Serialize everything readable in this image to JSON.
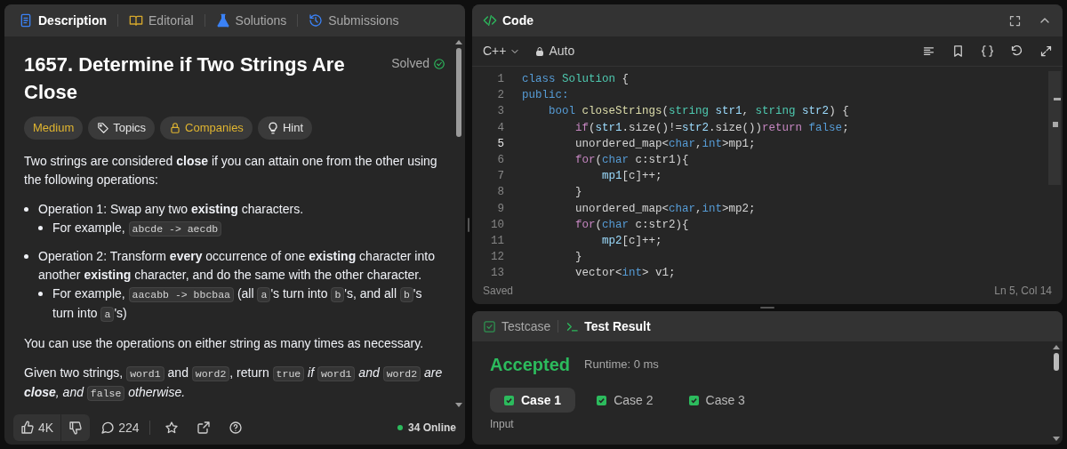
{
  "description_panel": {
    "tabs": [
      {
        "label": "Description",
        "selected": true
      },
      {
        "label": "Editorial",
        "selected": false
      },
      {
        "label": "Solutions",
        "selected": false
      },
      {
        "label": "Submissions",
        "selected": false
      }
    ],
    "title": "1657. Determine if Two Strings Are Close",
    "status": "Solved",
    "tags": [
      {
        "label": "Medium",
        "kind": "difficulty"
      },
      {
        "label": "Topics",
        "kind": "topics"
      },
      {
        "label": "Companies",
        "kind": "companies"
      },
      {
        "label": "Hint",
        "kind": "hint"
      }
    ],
    "content": [
      {
        "kind": "paragraph",
        "segments": [
          {
            "kind": "text",
            "text": "Two strings are considered **close** if you can attain one from the other using the following operations:"
          }
        ]
      },
      {
        "kind": "list",
        "items": [
          {
            "segments": [
              {
                "kind": "text",
                "text": "Operation 1: Swap any two **existing** characters."
              }
            ],
            "children": [
              {
                "segments": [
                  {
                    "kind": "text",
                    "text": "For example, "
                  },
                  {
                    "kind": "code",
                    "text": "abcde -> aecdb"
                  }
                ]
              }
            ]
          },
          {
            "segments": [
              {
                "kind": "text",
                "text": "Operation 2: Transform **every** occurrence of one **existing** character into another **existing** character, and do the same with the other character."
              }
            ],
            "children": [
              {
                "segments": [
                  {
                    "kind": "text",
                    "text": "For example, "
                  },
                  {
                    "kind": "code",
                    "text": "aacabb -> bbcbaa"
                  },
                  {
                    "kind": "text",
                    "text": " (all "
                  },
                  {
                    "kind": "code",
                    "text": "a"
                  },
                  {
                    "kind": "text",
                    "text": "'s turn into "
                  },
                  {
                    "kind": "code",
                    "text": "b"
                  },
                  {
                    "kind": "text",
                    "text": "'s, and all "
                  },
                  {
                    "kind": "code",
                    "text": "b"
                  },
                  {
                    "kind": "text",
                    "text": "'s turn into "
                  },
                  {
                    "kind": "code",
                    "text": "a"
                  },
                  {
                    "kind": "text",
                    "text": "'s)"
                  }
                ]
              }
            ]
          }
        ]
      },
      {
        "kind": "paragraph",
        "segments": [
          {
            "kind": "text",
            "text": "You can use the operations on either string as many times as necessary."
          }
        ]
      },
      {
        "kind": "paragraph",
        "segments": [
          {
            "kind": "text",
            "text": "Given two strings, "
          },
          {
            "kind": "code",
            "text": "word1"
          },
          {
            "kind": "text",
            "text": " and "
          },
          {
            "kind": "code",
            "text": "word2"
          },
          {
            "kind": "text",
            "text": ", return "
          },
          {
            "kind": "code",
            "text": "true"
          },
          {
            "kind": "emphasis",
            "text": " if "
          },
          {
            "kind": "code",
            "text": "word1"
          },
          {
            "kind": "emphasis",
            "text": " and "
          },
          {
            "kind": "code",
            "text": "word2"
          },
          {
            "kind": "emphasis",
            "text": " are "
          },
          {
            "kind": "strong_emphasis",
            "text": "close"
          },
          {
            "kind": "emphasis",
            "text": ", and "
          },
          {
            "kind": "code",
            "text": "false"
          },
          {
            "kind": "emphasis",
            "text": " otherwise."
          }
        ]
      }
    ],
    "footer": {
      "likes": "4K",
      "comments": "224",
      "online": "34 Online"
    }
  },
  "code_panel": {
    "title": "Code",
    "language": "C++",
    "mode": "Auto",
    "lines": [
      {
        "number": "1",
        "current": false,
        "tokens": [
          {
            "kind": "keyword",
            "text": "class "
          },
          {
            "kind": "type",
            "text": "Solution"
          },
          {
            "kind": "plain",
            "text": " {"
          }
        ]
      },
      {
        "number": "2",
        "current": false,
        "tokens": [
          {
            "kind": "keyword",
            "text": "public:"
          }
        ]
      },
      {
        "number": "3",
        "current": false,
        "tokens": [
          {
            "kind": "keyword",
            "text": "    bool "
          },
          {
            "kind": "function",
            "text": "closeStrings"
          },
          {
            "kind": "plain",
            "text": "("
          },
          {
            "kind": "type",
            "text": "string "
          },
          {
            "kind": "variable",
            "text": "str1"
          },
          {
            "kind": "plain",
            "text": ", "
          },
          {
            "kind": "type",
            "text": "string "
          },
          {
            "kind": "variable",
            "text": "str2"
          },
          {
            "kind": "plain",
            "text": ") {"
          }
        ]
      },
      {
        "number": "4",
        "current": false,
        "tokens": [
          {
            "kind": "control",
            "text": "        if"
          },
          {
            "kind": "plain",
            "text": "("
          },
          {
            "kind": "variable",
            "text": "str1"
          },
          {
            "kind": "plain",
            "text": ".size()!="
          },
          {
            "kind": "variable",
            "text": "str2"
          },
          {
            "kind": "plain",
            "text": ".size())"
          },
          {
            "kind": "control",
            "text": "return "
          },
          {
            "kind": "keyword",
            "text": "false"
          },
          {
            "kind": "plain",
            "text": ";"
          }
        ]
      },
      {
        "number": "5",
        "current": true,
        "tokens": [
          {
            "kind": "plain",
            "text": "        unordered_map<"
          },
          {
            "kind": "keyword",
            "text": "char"
          },
          {
            "kind": "plain",
            "text": ","
          },
          {
            "kind": "keyword",
            "text": "int"
          },
          {
            "kind": "plain",
            "text": ">mp1;"
          }
        ]
      },
      {
        "number": "6",
        "current": false,
        "tokens": [
          {
            "kind": "control",
            "text": "        for"
          },
          {
            "kind": "plain",
            "text": "("
          },
          {
            "kind": "keyword",
            "text": "char"
          },
          {
            "kind": "plain",
            "text": " c:str1){"
          }
        ]
      },
      {
        "number": "7",
        "current": false,
        "tokens": [
          {
            "kind": "variable",
            "text": "            mp1"
          },
          {
            "kind": "plain",
            "text": "[c]++;"
          }
        ]
      },
      {
        "number": "8",
        "current": false,
        "tokens": [
          {
            "kind": "plain",
            "text": "        }"
          }
        ]
      },
      {
        "number": "9",
        "current": false,
        "tokens": [
          {
            "kind": "plain",
            "text": "        unordered_map<"
          },
          {
            "kind": "keyword",
            "text": "char"
          },
          {
            "kind": "plain",
            "text": ","
          },
          {
            "kind": "keyword",
            "text": "int"
          },
          {
            "kind": "plain",
            "text": ">mp2;"
          }
        ]
      },
      {
        "number": "10",
        "current": false,
        "tokens": [
          {
            "kind": "control",
            "text": "        for"
          },
          {
            "kind": "plain",
            "text": "("
          },
          {
            "kind": "keyword",
            "text": "char"
          },
          {
            "kind": "plain",
            "text": " c:str2){"
          }
        ]
      },
      {
        "number": "11",
        "current": false,
        "tokens": [
          {
            "kind": "variable",
            "text": "            mp2"
          },
          {
            "kind": "plain",
            "text": "[c]++;"
          }
        ]
      },
      {
        "number": "12",
        "current": false,
        "tokens": [
          {
            "kind": "plain",
            "text": "        }"
          }
        ]
      },
      {
        "number": "13",
        "current": false,
        "tokens": [
          {
            "kind": "plain",
            "text": "        vector<"
          },
          {
            "kind": "keyword",
            "text": "int"
          },
          {
            "kind": "plain",
            "text": "> v1;"
          }
        ]
      }
    ],
    "status": "Saved",
    "cursor": "Ln 5, Col 14"
  },
  "test_panel": {
    "tabs": [
      {
        "label": "Testcase",
        "selected": false
      },
      {
        "label": "Test Result",
        "selected": true
      }
    ],
    "verdict": "Accepted",
    "runtime": "Runtime: 0 ms",
    "cases": [
      {
        "label": "Case 1",
        "selected": true,
        "passed": true
      },
      {
        "label": "Case 2",
        "selected": false,
        "passed": true
      },
      {
        "label": "Case 3",
        "selected": false,
        "passed": true
      }
    ],
    "section_label": "Input"
  }
}
